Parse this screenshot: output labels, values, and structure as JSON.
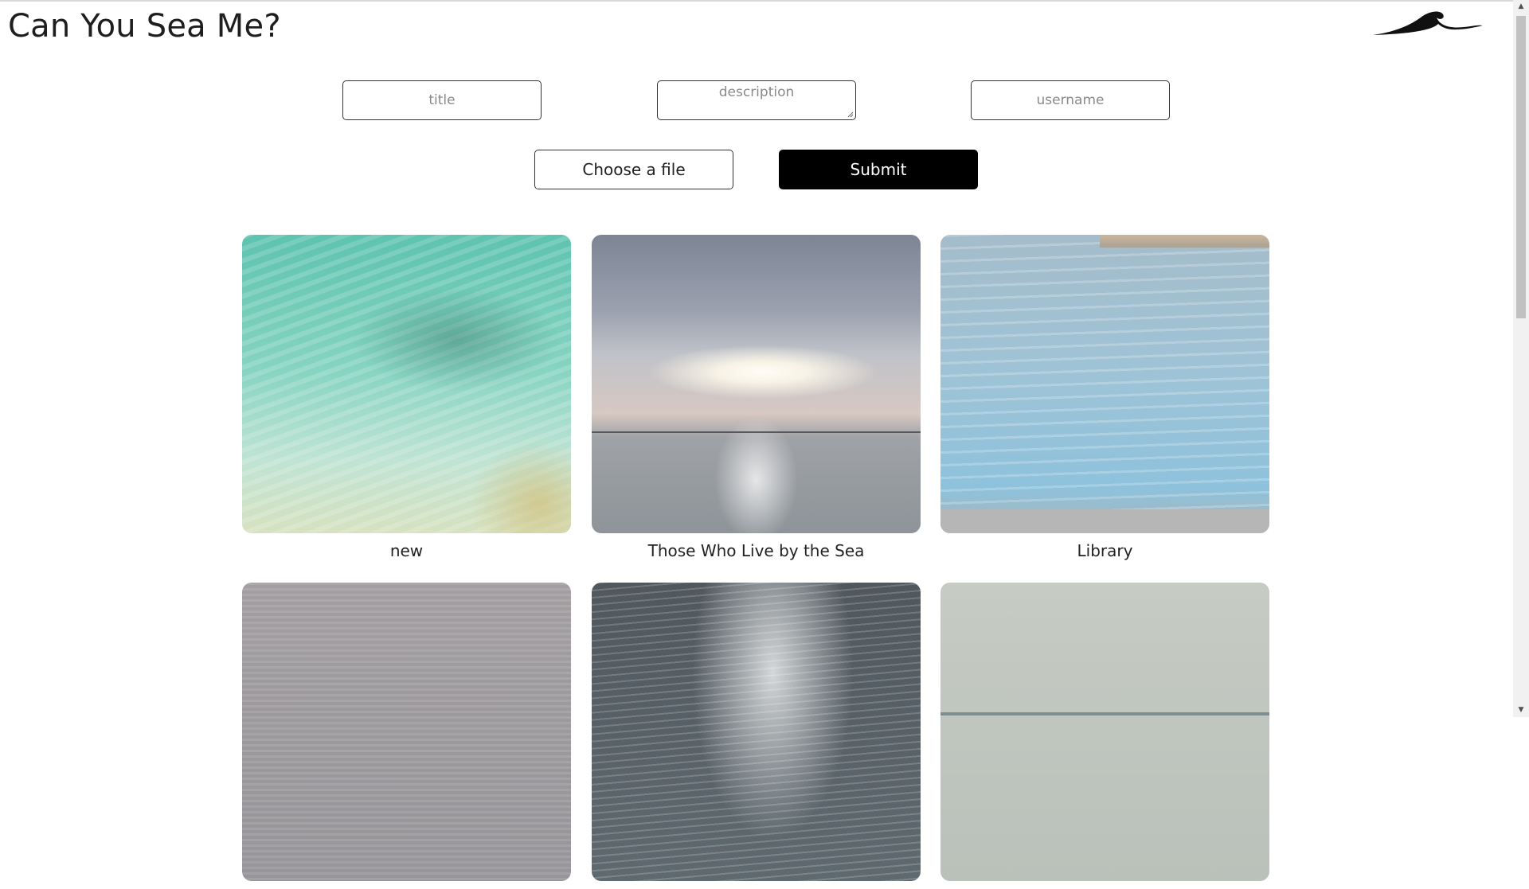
{
  "header": {
    "title": "Can You Sea Me?",
    "logo_icon": "wave-icon"
  },
  "form": {
    "title_placeholder": "title",
    "description_placeholder": "description",
    "username_placeholder": "username",
    "file_button_label": "Choose a file",
    "submit_label": "Submit"
  },
  "gallery": {
    "posts": [
      {
        "caption": "new",
        "image": "clear turquoise shallow water"
      },
      {
        "caption": "Those Who Live by the Sea",
        "image": "cloudy sunset over the sea"
      },
      {
        "caption": "Library",
        "image": "calm blue water by a pier"
      },
      {
        "caption": "",
        "image": "grey rippled sea"
      },
      {
        "caption": "",
        "image": "sunlight sparkling on dark water"
      },
      {
        "caption": "",
        "image": "pale misty sea horizon"
      }
    ]
  },
  "colors": {
    "submit_background": "#000000",
    "submit_text": "#ffffff",
    "page_background": "#ffffff"
  }
}
